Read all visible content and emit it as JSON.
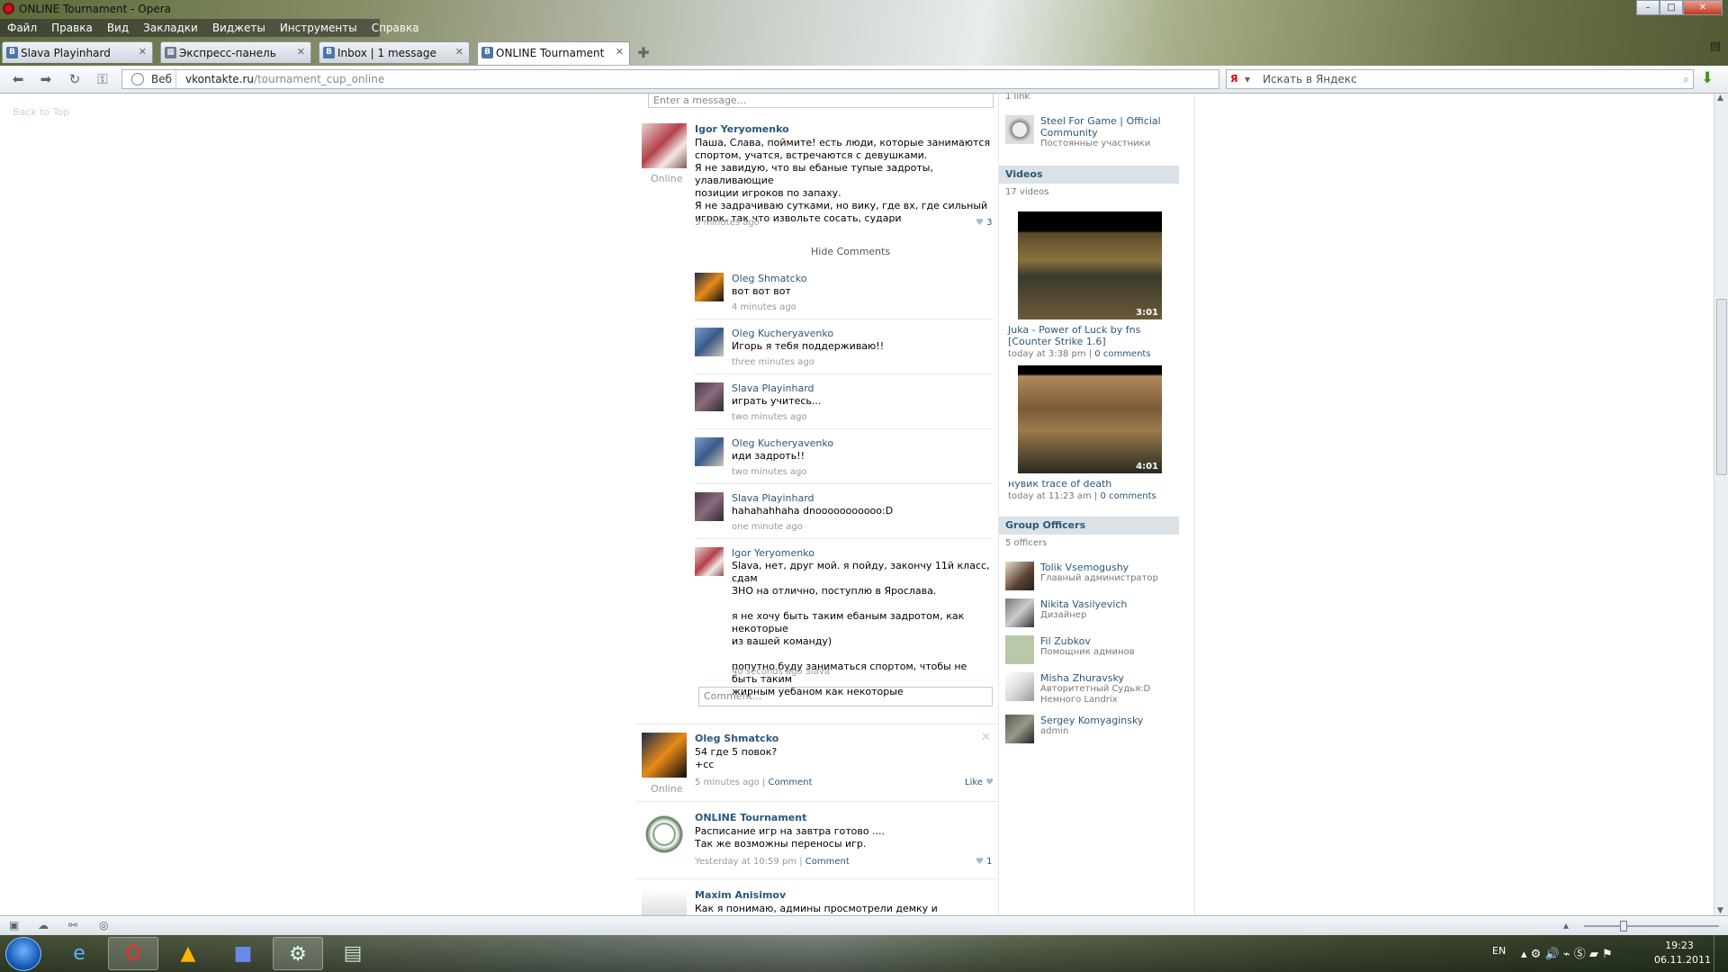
{
  "window": {
    "title": "ONLINE Tournament - Opera"
  },
  "menu": [
    "Файл",
    "Правка",
    "Вид",
    "Закладки",
    "Виджеты",
    "Инструменты",
    "Справка"
  ],
  "tabs": [
    {
      "label": "Slava Playinhard",
      "icon": "vk-icon"
    },
    {
      "label": "Экспресс-панель",
      "icon": "speed-dial-icon"
    },
    {
      "label": "Inbox | 1 message",
      "icon": "vk-icon"
    },
    {
      "label": "ONLINE Tournament",
      "icon": "vk-icon"
    }
  ],
  "address": {
    "web_label": "Веб",
    "domain": "vkontakte.ru",
    "path": "/tournament_cup_online"
  },
  "search": {
    "placeholder": "Искать в Яндекс",
    "engine": "Я"
  },
  "page": {
    "back_to_top": "Back to Top",
    "message_placeholder": "Enter a message...",
    "comment_placeholder": "Comment...",
    "hide_comments": "Hide Comments"
  },
  "posts": [
    {
      "author": "Igor Yeryomenko",
      "status": "Online",
      "text": [
        "Паша, Слава, поймите! есть люди, которые занимаются",
        "спортом, учатся, встречаются с девушками.",
        "Я не завидую, что вы ебаные тупые задроты, улавливающие",
        "позиции игроков по запаху.",
        "Я не задрачиваю сутками, но вику, где вх, где сильный",
        "игрок. так что извольте сосать, судари"
      ],
      "time": "5 minutes ago",
      "likes": "3",
      "comments": [
        {
          "author": "Oleg Shmatcko",
          "text": [
            "вот вот вот"
          ],
          "time": "4 minutes ago"
        },
        {
          "author": "Oleg Kucheryavenko",
          "text": [
            "Игорь я тебя поддерживаю!!"
          ],
          "time": "three minutes ago"
        },
        {
          "author": "Slava Playinhard",
          "text": [
            "играть учитесь..."
          ],
          "time": "two minutes ago"
        },
        {
          "author": "Oleg Kucheryavenko",
          "text": [
            "иди задроть!!"
          ],
          "time": "two minutes ago"
        },
        {
          "author": "Slava Playinhard",
          "text": [
            "hahahahhaha dnooooooooooo:D"
          ],
          "time": "one minute ago"
        },
        {
          "author": "Igor Yeryomenko",
          "text": [
            "Slava, нет, друг мой. я пойду, закончу 11й класс, сдам",
            "ЗНО на отлично, поступлю в Ярослава.",
            "",
            "я не хочу быть таким ебаным задротом, как некоторые",
            "из вашей команду)",
            "",
            "попутно буду заниматься спортом, чтобы не быть таким",
            "жирным уебаном как некоторые"
          ],
          "time": "40 seconds ago Slava"
        }
      ]
    },
    {
      "author": "Oleg Shmatcko",
      "status": "Online",
      "text": [
        "54 где 5 повок?",
        "+сс"
      ],
      "time": "5 minutes ago",
      "comment_link": "Comment",
      "like_label": "Like"
    },
    {
      "author": "ONLINE Tournament",
      "text": [
        "Расписание игр на завтра готово ....",
        "Так же возможны переносы игр."
      ],
      "time": "Yesterday at 10:59 pm",
      "comment_link": "Comment",
      "likes": "1"
    },
    {
      "author": "Maxim Anisimov",
      "text": [
        "Как я понимаю, админы просмотрели демку и поставили нам"
      ]
    }
  ],
  "sidebar": {
    "links_count": "1 link",
    "link": {
      "name": "Steel For Game | Official Community",
      "desc": "Постоянные участники"
    },
    "videos_title": "Videos",
    "videos_count": "17 videos",
    "videos": [
      {
        "title": "Juka - Power of Luck by fns [Counter Strike 1.6]",
        "duration": "3:01",
        "date": "today at 3:38 pm",
        "comments": "0 comments"
      },
      {
        "title": "нувик trace of death",
        "duration": "4:01",
        "date": "today at 11:23 am",
        "comments": "0 comments"
      }
    ],
    "officers_title": "Group Officers",
    "officers_count": "5 officers",
    "officers": [
      {
        "name": "Tolik Vsemogushy",
        "role": "Главный администратор"
      },
      {
        "name": "Nikita Vasilyevich",
        "role": "Дизайнер"
      },
      {
        "name": "Fil Zubkov",
        "role": "Помощник админов"
      },
      {
        "name": "Misha Zhuravsky",
        "role": [
          "Авторитетный Судья:D",
          "Немного Landrix"
        ]
      },
      {
        "name": "Sergey Komyaginsky",
        "role": "admin"
      }
    ]
  },
  "taskbar": {
    "lang": "EN",
    "time": "19:23",
    "date": "06.11.2011"
  }
}
